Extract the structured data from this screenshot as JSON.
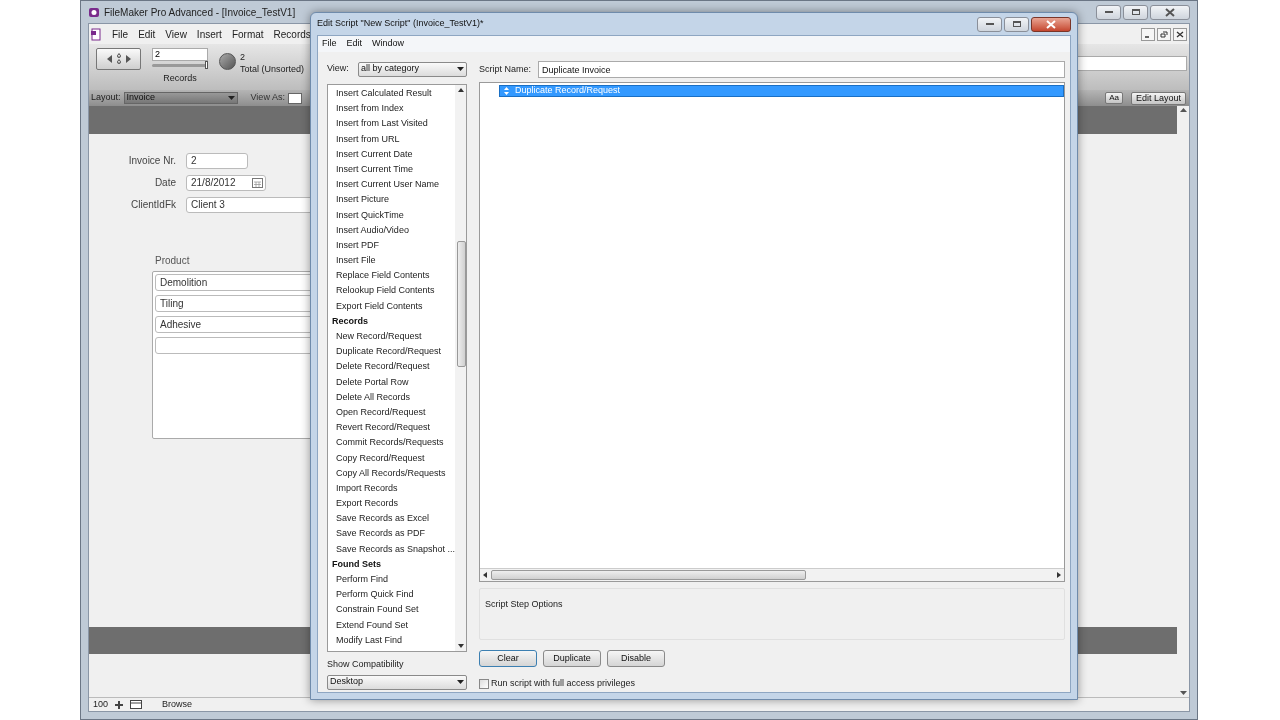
{
  "app_window": {
    "title": "FileMaker Pro Advanced - [Invoice_TestV1]",
    "menus": [
      "File",
      "Edit",
      "View",
      "Insert",
      "Format",
      "Records"
    ]
  },
  "toolbar": {
    "record_number": "2",
    "records_label": "Records",
    "record_slider": {
      "level": 1
    },
    "found_count": "2",
    "total_label": "Total (Unsorted)"
  },
  "layout_bar": {
    "layout_label": "Layout:",
    "layout_value": "Invoice",
    "view_as_label": "View As:",
    "aa_button": "Aa",
    "edit_layout_button": "Edit Layout"
  },
  "form": {
    "fields": [
      {
        "label": "Invoice Nr.",
        "value": "2",
        "kind": "text"
      },
      {
        "label": "Date",
        "value": "21/8/2012",
        "kind": "date"
      },
      {
        "label": "ClientIdFk",
        "value": "Client 3",
        "kind": "text"
      }
    ],
    "portal": {
      "label": "Product",
      "rows": [
        "Demolition",
        "Tiling",
        "Adhesive"
      ]
    }
  },
  "status_bar": {
    "zoom": "100",
    "mode": "Browse"
  },
  "dialog": {
    "title": "Edit Script \"New Script\" (Invoice_TestV1)*",
    "menus": [
      "File",
      "Edit",
      "Window"
    ],
    "view_label": "View:",
    "view_value": "all by category",
    "steps_list": [
      {
        "text": "Insert Calculated Result",
        "kind": "step"
      },
      {
        "text": "Insert from Index",
        "kind": "step"
      },
      {
        "text": "Insert from Last Visited",
        "kind": "step"
      },
      {
        "text": "Insert from URL",
        "kind": "step"
      },
      {
        "text": "Insert Current Date",
        "kind": "step"
      },
      {
        "text": "Insert Current Time",
        "kind": "step"
      },
      {
        "text": "Insert Current User Name",
        "kind": "step"
      },
      {
        "text": "Insert Picture",
        "kind": "step"
      },
      {
        "text": "Insert QuickTime",
        "kind": "step"
      },
      {
        "text": "Insert Audio/Video",
        "kind": "step"
      },
      {
        "text": "Insert PDF",
        "kind": "step"
      },
      {
        "text": "Insert File",
        "kind": "step"
      },
      {
        "text": "Replace Field Contents",
        "kind": "step"
      },
      {
        "text": "Relookup Field Contents",
        "kind": "step"
      },
      {
        "text": "Export Field Contents",
        "kind": "step"
      },
      {
        "text": "Records",
        "kind": "category"
      },
      {
        "text": "New Record/Request",
        "kind": "step"
      },
      {
        "text": "Duplicate Record/Request",
        "kind": "step"
      },
      {
        "text": "Delete Record/Request",
        "kind": "step"
      },
      {
        "text": "Delete Portal Row",
        "kind": "step"
      },
      {
        "text": "Delete All Records",
        "kind": "step"
      },
      {
        "text": "Open Record/Request",
        "kind": "step"
      },
      {
        "text": "Revert Record/Request",
        "kind": "step"
      },
      {
        "text": "Commit Records/Requests",
        "kind": "step"
      },
      {
        "text": "Copy Record/Request",
        "kind": "step"
      },
      {
        "text": "Copy All Records/Requests",
        "kind": "step"
      },
      {
        "text": "Import Records",
        "kind": "step"
      },
      {
        "text": "Export Records",
        "kind": "step"
      },
      {
        "text": "Save Records as Excel",
        "kind": "step"
      },
      {
        "text": "Save Records as PDF",
        "kind": "step"
      },
      {
        "text": "Save Records as Snapshot ...",
        "kind": "step"
      },
      {
        "text": "Found Sets",
        "kind": "category"
      },
      {
        "text": "Perform Find",
        "kind": "step"
      },
      {
        "text": "Perform Quick Find",
        "kind": "step"
      },
      {
        "text": "Constrain Found Set",
        "kind": "step"
      },
      {
        "text": "Extend Found Set",
        "kind": "step"
      },
      {
        "text": "Modify Last Find",
        "kind": "step"
      }
    ],
    "compatibility_label": "Show Compatibility",
    "compatibility_value": "Desktop",
    "script_name_label": "Script Name:",
    "script_name": "Duplicate Invoice",
    "script_steps": [
      {
        "text": "Duplicate Record/Request",
        "selected": true
      }
    ],
    "options_label": "Script Step Options",
    "buttons": [
      "Clear",
      "Duplicate",
      "Disable"
    ],
    "full_access": {
      "label": "Run script with full access privileges",
      "checked": false
    }
  }
}
